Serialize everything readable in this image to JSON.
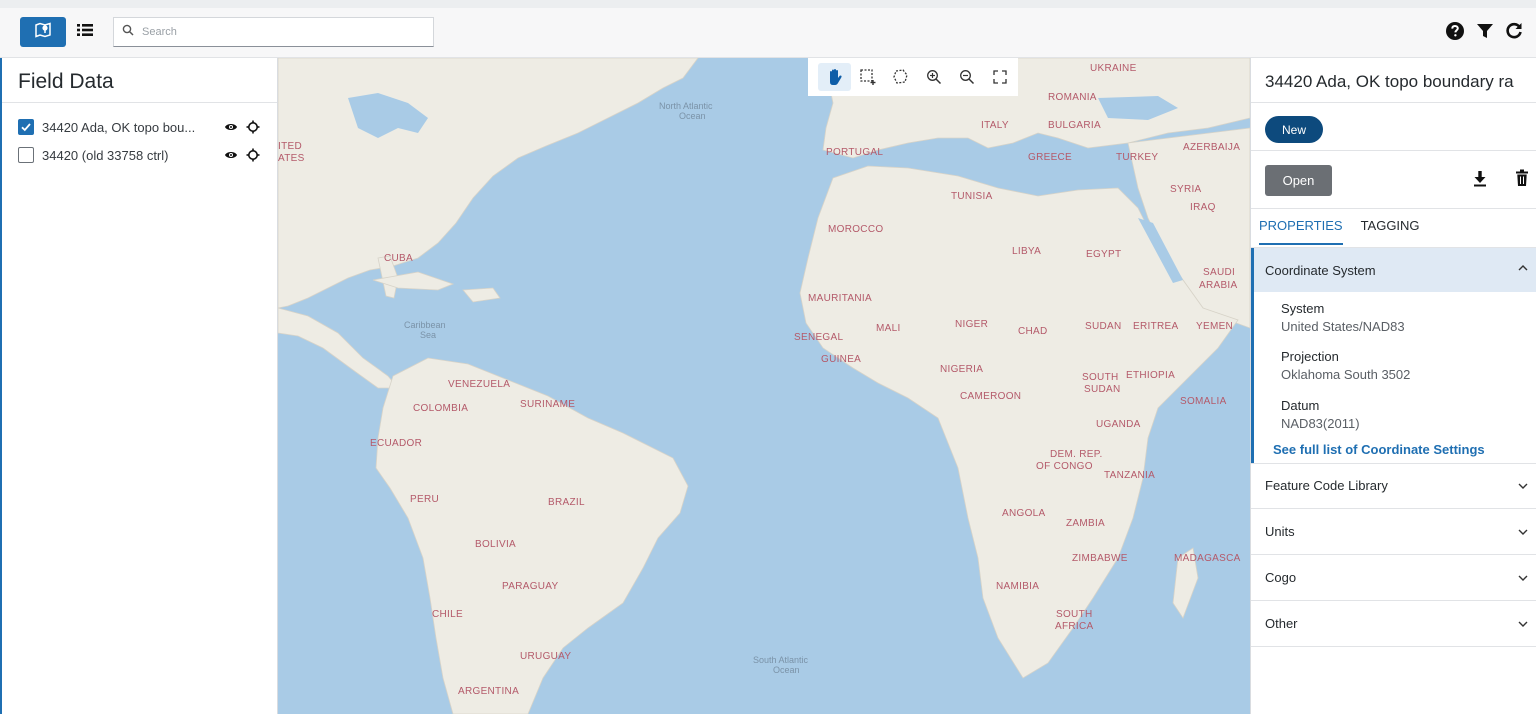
{
  "topbar": {
    "search": {
      "placeholder": "Search",
      "value": ""
    },
    "icons": [
      "map-view-icon",
      "list-view-icon",
      "search-icon",
      "help-icon",
      "filter-icon",
      "refresh-icon"
    ]
  },
  "left_panel": {
    "title": "Field Data",
    "layers": [
      {
        "label": "34420 Ada, OK topo bou...",
        "checked": true
      },
      {
        "label": "34420 (old 33758 ctrl)",
        "checked": false
      }
    ]
  },
  "map": {
    "toolbar": [
      "pan-hand-icon",
      "box-select-icon",
      "lasso-select-icon",
      "zoom-in-icon",
      "zoom-out-icon",
      "fit-extent-icon"
    ],
    "labels": {
      "ukraine": "UKRAINE",
      "romania": "ROMANIA",
      "italy": "ITALY",
      "bulgaria": "BULGARIA",
      "azerbaijan": "AZERBAIJA",
      "portugal": "PORTUGAL",
      "greece": "GREECE",
      "turkey": "TURKEY",
      "syria": "SYRIA",
      "iraq": "IRAQ",
      "tunisia": "TUNISIA",
      "morocco": "MOROCCO",
      "libya": "LIBYA",
      "egypt": "EGYPT",
      "saudi": "SAUDI",
      "arabia": "ARABIA",
      "cuba": "CUBA",
      "mauritania": "MAURITANIA",
      "mali": "MALI",
      "niger": "NIGER",
      "chad": "CHAD",
      "sudan": "SUDAN",
      "eritrea": "ERITREA",
      "yemen": "YEMEN",
      "senegal": "SENEGAL",
      "guinea": "GUINEA",
      "nigeria": "NIGERIA",
      "south_sudan_1": "SOUTH",
      "south_sudan_2": "SUDAN",
      "ethiopia": "ETHIOPIA",
      "somalia": "SOMALIA",
      "venezuela": "VENEZUELA",
      "suriname": "SURINAME",
      "colombia": "COLOMBIA",
      "cameroon": "CAMEROON",
      "uganda": "UGANDA",
      "ecuador": "ECUADOR",
      "dem_rep_1": "DEM. REP.",
      "dem_rep_2": "OF CONGO",
      "tanzania": "TANZANIA",
      "peru": "PERU",
      "brazil": "BRAZIL",
      "angola": "ANGOLA",
      "zambia": "ZAMBIA",
      "bolivia": "BOLIVIA",
      "zimbabwe": "ZIMBABWE",
      "madagascar": "MADAGASCA",
      "paraguay": "PARAGUAY",
      "namibia": "NAMIBIA",
      "south_africa_1": "SOUTH",
      "south_africa_2": "AFRICA",
      "chile": "CHILE",
      "uruguay": "URUGUAY",
      "argentina": "ARGENTINA",
      "united_states_1": "ITED",
      "united_states_2": "ATES",
      "north_atlantic_1": "North Atlantic",
      "north_atlantic_2": "Ocean",
      "caribbean_1": "Caribbean",
      "caribbean_2": "Sea",
      "south_atlantic_1": "South Atlantic",
      "south_atlantic_2": "Ocean"
    }
  },
  "right_panel": {
    "title": "34420 Ada, OK topo boundary ra",
    "new_label": "New",
    "open_label": "Open",
    "tabs": [
      {
        "label": "PROPERTIES",
        "active": true
      },
      {
        "label": "TAGGING",
        "active": false
      }
    ],
    "coordinate_system": {
      "header": "Coordinate System",
      "expanded": true,
      "system_label": "System",
      "system_value": "United States/NAD83",
      "projection_label": "Projection",
      "projection_value": "Oklahoma South 3502",
      "datum_label": "Datum",
      "datum_value": "NAD83(2011)",
      "link": "See full list of Coordinate Settings"
    },
    "sections": [
      {
        "label": "Feature Code Library",
        "expanded": false
      },
      {
        "label": "Units",
        "expanded": false
      },
      {
        "label": "Cogo",
        "expanded": false
      },
      {
        "label": "Other",
        "expanded": false
      }
    ]
  },
  "colors": {
    "accent": "#1f6fb2",
    "new_button": "#0d4a7d",
    "open_button": "#6b6f74",
    "ocean": "#a9cbe6",
    "land": "#eeece4",
    "country_label": "#b45a6a",
    "expanded_header": "#dfe9f4"
  }
}
